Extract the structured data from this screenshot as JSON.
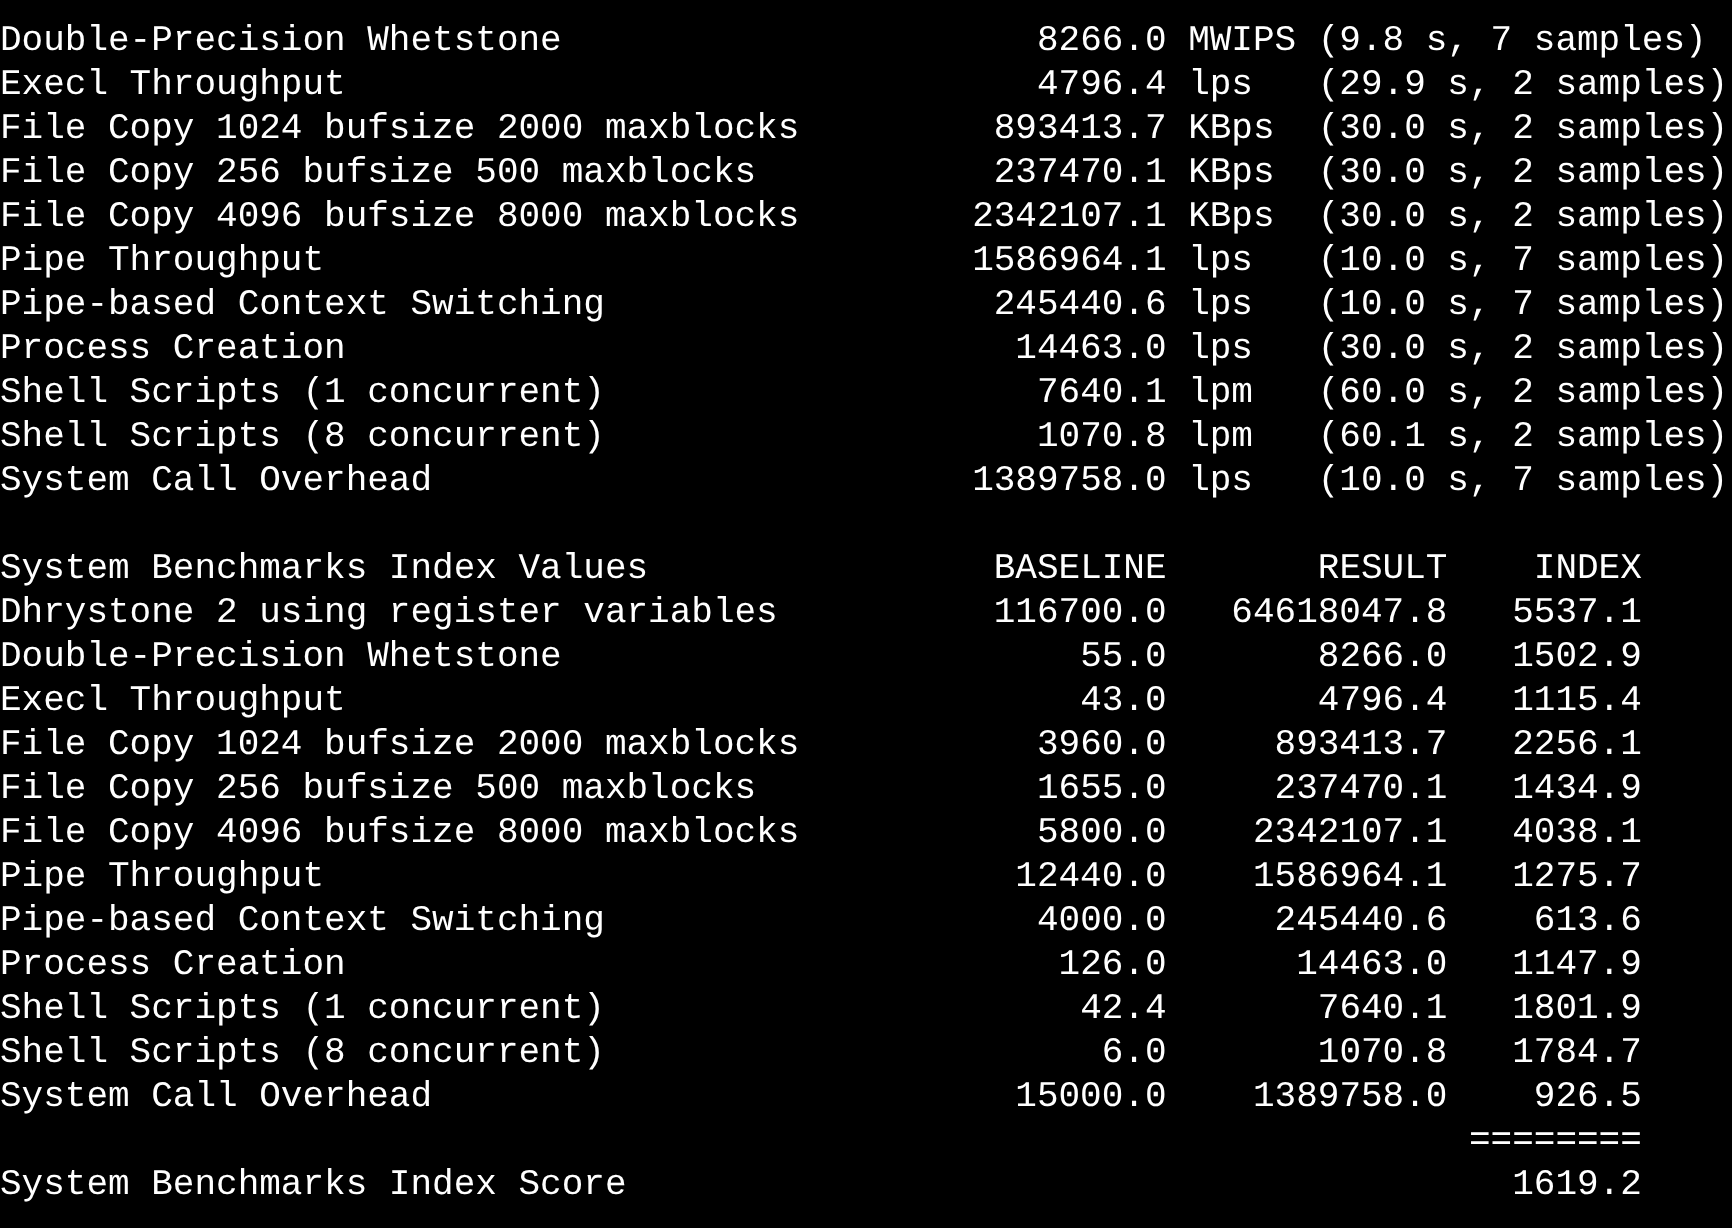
{
  "tests": [
    {
      "name": "Double-Precision Whetstone",
      "value": "8266.0",
      "unit": "MWIPS",
      "detail": "(9.8 s, 7 samples)"
    },
    {
      "name": "Execl Throughput",
      "value": "4796.4",
      "unit": "lps",
      "detail": "(29.9 s, 2 samples)"
    },
    {
      "name": "File Copy 1024 bufsize 2000 maxblocks",
      "value": "893413.7",
      "unit": "KBps",
      "detail": "(30.0 s, 2 samples)"
    },
    {
      "name": "File Copy 256 bufsize 500 maxblocks",
      "value": "237470.1",
      "unit": "KBps",
      "detail": "(30.0 s, 2 samples)"
    },
    {
      "name": "File Copy 4096 bufsize 8000 maxblocks",
      "value": "2342107.1",
      "unit": "KBps",
      "detail": "(30.0 s, 2 samples)"
    },
    {
      "name": "Pipe Throughput",
      "value": "1586964.1",
      "unit": "lps",
      "detail": "(10.0 s, 7 samples)"
    },
    {
      "name": "Pipe-based Context Switching",
      "value": "245440.6",
      "unit": "lps",
      "detail": "(10.0 s, 7 samples)"
    },
    {
      "name": "Process Creation",
      "value": "14463.0",
      "unit": "lps",
      "detail": "(30.0 s, 2 samples)"
    },
    {
      "name": "Shell Scripts (1 concurrent)",
      "value": "7640.1",
      "unit": "lpm",
      "detail": "(60.0 s, 2 samples)"
    },
    {
      "name": "Shell Scripts (8 concurrent)",
      "value": "1070.8",
      "unit": "lpm",
      "detail": "(60.1 s, 2 samples)"
    },
    {
      "name": "System Call Overhead",
      "value": "1389758.0",
      "unit": "lps",
      "detail": "(10.0 s, 7 samples)"
    }
  ],
  "index": {
    "columns": [
      "System Benchmarks Index Values",
      "BASELINE",
      "RESULT",
      "INDEX"
    ],
    "rows": [
      {
        "name": "Dhrystone 2 using register variables",
        "baseline": "116700.0",
        "result": "64618047.8",
        "index": "5537.1"
      },
      {
        "name": "Double-Precision Whetstone",
        "baseline": "55.0",
        "result": "8266.0",
        "index": "1502.9"
      },
      {
        "name": "Execl Throughput",
        "baseline": "43.0",
        "result": "4796.4",
        "index": "1115.4"
      },
      {
        "name": "File Copy 1024 bufsize 2000 maxblocks",
        "baseline": "3960.0",
        "result": "893413.7",
        "index": "2256.1"
      },
      {
        "name": "File Copy 256 bufsize 500 maxblocks",
        "baseline": "1655.0",
        "result": "237470.1",
        "index": "1434.9"
      },
      {
        "name": "File Copy 4096 bufsize 8000 maxblocks",
        "baseline": "5800.0",
        "result": "2342107.1",
        "index": "4038.1"
      },
      {
        "name": "Pipe Throughput",
        "baseline": "12440.0",
        "result": "1586964.1",
        "index": "1275.7"
      },
      {
        "name": "Pipe-based Context Switching",
        "baseline": "4000.0",
        "result": "245440.6",
        "index": "613.6"
      },
      {
        "name": "Process Creation",
        "baseline": "126.0",
        "result": "14463.0",
        "index": "1147.9"
      },
      {
        "name": "Shell Scripts (1 concurrent)",
        "baseline": "42.4",
        "result": "7640.1",
        "index": "1801.9"
      },
      {
        "name": "Shell Scripts (8 concurrent)",
        "baseline": "6.0",
        "result": "1070.8",
        "index": "1784.7"
      },
      {
        "name": "System Call Overhead",
        "baseline": "15000.0",
        "result": "1389758.0",
        "index": "926.5"
      }
    ],
    "separator": "========",
    "score": {
      "label": "System Benchmarks Index Score",
      "value": "1619.2"
    }
  }
}
